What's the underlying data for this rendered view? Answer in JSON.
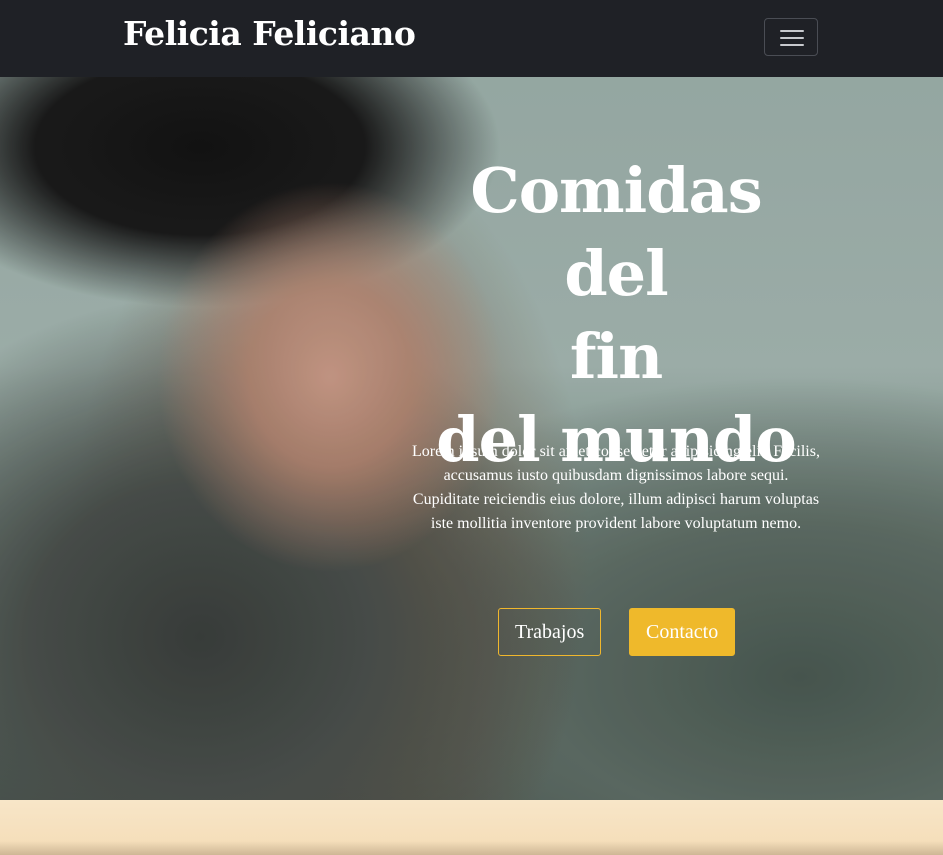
{
  "navbar": {
    "brand": "Felicia Feliciano",
    "menu_icon": "hamburger-menu-icon"
  },
  "hero": {
    "title_line1": "Comidas del",
    "title_line2": "fin",
    "title_line3": "del mundo",
    "text": "Lorem ipsum dolor sit amet consectetur adipisicing elit. Facilis, accusamus iusto quibusdam dignissimos labore sequi. Cupiditate reiciendis eius dolore, illum adipisci harum voluptas iste mollitia inventore provident labore voluptatum nemo.",
    "button_trabajos": "Trabajos",
    "button_contacto": "Contacto"
  },
  "colors": {
    "navbar_bg": "#1f2126",
    "accent": "#efb92b",
    "section_bg": "#f6e2c3"
  }
}
